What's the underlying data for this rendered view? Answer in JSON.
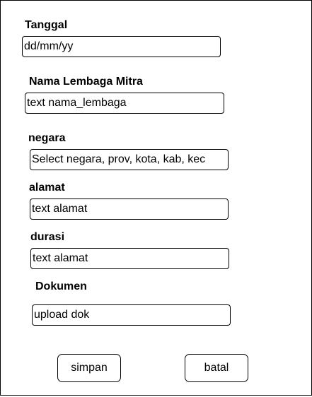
{
  "form": {
    "tanggal": {
      "label": "Tanggal",
      "value": "dd/mm/yy"
    },
    "nama_lembaga": {
      "label": "Nama Lembaga Mitra",
      "value": "text nama_lembaga"
    },
    "negara": {
      "label": "negara",
      "value": "Select negara, prov, kota, kab, kec"
    },
    "alamat": {
      "label": "alamat",
      "value": "text alamat"
    },
    "durasi": {
      "label": "durasi",
      "value": "text alamat"
    },
    "dokumen": {
      "label": "Dokumen",
      "value": "upload dok"
    }
  },
  "actions": {
    "save_label": "simpan",
    "cancel_label": "batal"
  },
  "colors": {
    "border": "#000000",
    "background": "#ffffff",
    "text": "#000000"
  }
}
